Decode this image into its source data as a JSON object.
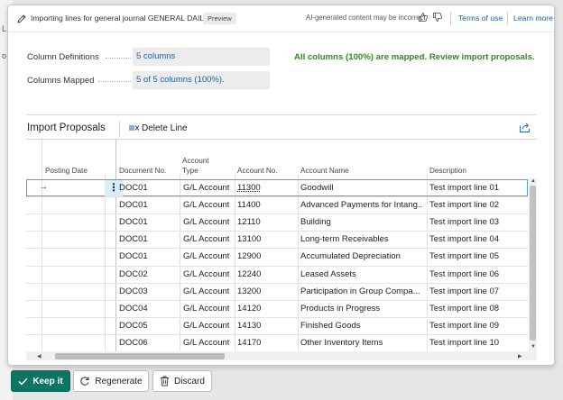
{
  "background": {
    "fragments": [
      "L",
      "o"
    ]
  },
  "dialog": {
    "title": "Importing lines for general journal GENERAL DAILY",
    "badge": "Preview",
    "ai_note": "AI-generated content may be incorrect",
    "links": {
      "terms": "Terms of use",
      "learn_more": "Learn more"
    }
  },
  "summary": {
    "column_definitions_label": "Column Definitions",
    "column_definitions_value": "5 columns",
    "columns_mapped_label": "Columns Mapped",
    "columns_mapped_value": "5 of 5 columns (100%).",
    "status_message": "All columns (100%) are mapped. Review import proposals."
  },
  "proposals": {
    "title": "Import Proposals",
    "delete_label": "Delete Line",
    "columns": {
      "posting_date": "Posting Date",
      "document_no": "Document No.",
      "account_type_1": "Account",
      "account_type_2": "Type",
      "account_no": "Account No.",
      "account_name": "Account Name",
      "description": "Description"
    },
    "rows": [
      {
        "doc": "DOC01",
        "type": "G/L Account",
        "acc": "11300",
        "name": "Goodwill",
        "desc": "Test import line 01"
      },
      {
        "doc": "DOC01",
        "type": "G/L Account",
        "acc": "11400",
        "name": "Advanced Payments for Intang...",
        "desc": "Test import line 02"
      },
      {
        "doc": "DOC01",
        "type": "G/L Account",
        "acc": "12110",
        "name": "Building",
        "desc": "Test import line 03"
      },
      {
        "doc": "DOC01",
        "type": "G/L Account",
        "acc": "13100",
        "name": "Long-term Receivables",
        "desc": "Test import line 04"
      },
      {
        "doc": "DOC01",
        "type": "G/L Account",
        "acc": "12900",
        "name": "Accumulated Depreciation",
        "desc": "Test import line 05"
      },
      {
        "doc": "DOC02",
        "type": "G/L Account",
        "acc": "12240",
        "name": "Leased Assets",
        "desc": "Test import line 06"
      },
      {
        "doc": "DOC03",
        "type": "G/L Account",
        "acc": "13200",
        "name": "Participation in Group Compa...",
        "desc": "Test import line 07"
      },
      {
        "doc": "DOC04",
        "type": "G/L Account",
        "acc": "14120",
        "name": "Products in Progress",
        "desc": "Test import line 08"
      },
      {
        "doc": "DOC05",
        "type": "G/L Account",
        "acc": "14130",
        "name": "Finished Goods",
        "desc": "Test import line 09"
      },
      {
        "doc": "DOC06",
        "type": "G/L Account",
        "acc": "14170",
        "name": "Other Inventory Items",
        "desc": "Test import line 10"
      }
    ]
  },
  "footer": {
    "keep_label": "Keep it",
    "regenerate_label": "Regenerate",
    "discard_label": "Discard"
  },
  "colors": {
    "accent": "#0e7564",
    "link": "#1f5fa6",
    "success": "#2e8b1e",
    "selection": "#d8eef7"
  },
  "icons": {
    "title": "pencil-icon",
    "like": "thumbs-up-icon",
    "dislike": "thumbs-down-icon",
    "delete": "delete-row-icon",
    "share": "share-icon",
    "keep": "checkmark-icon",
    "regenerate": "refresh-icon",
    "discard": "trash-icon"
  }
}
